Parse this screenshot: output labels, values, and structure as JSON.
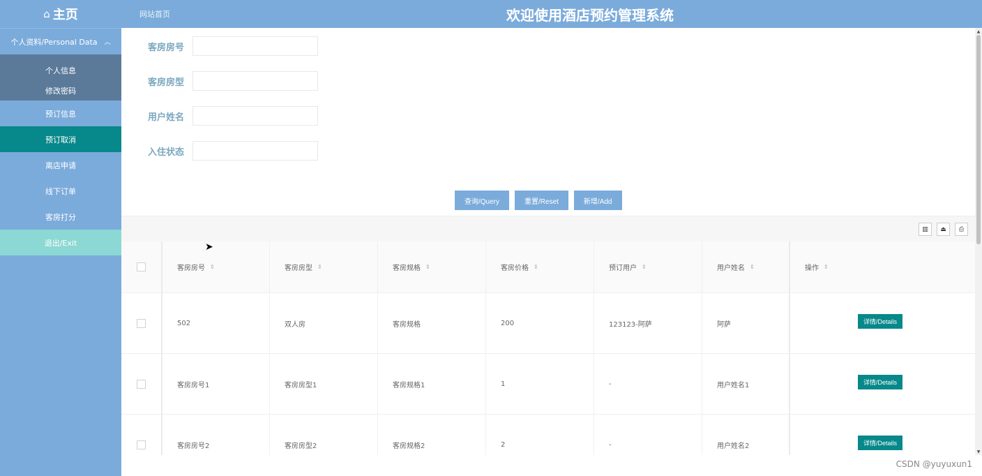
{
  "header": {
    "home_label": "主页",
    "site_link": "网站首页",
    "title": "欢迎使用酒店预约管理系统"
  },
  "sidebar": {
    "group_label": "个人资料/Personal Data",
    "sub_items": [
      {
        "label": "个人信息"
      },
      {
        "label": "修改密码"
      }
    ],
    "items": [
      {
        "label": "预订信息"
      },
      {
        "label": "预订取消"
      },
      {
        "label": "离店申请"
      },
      {
        "label": "线下订单"
      },
      {
        "label": "客房打分"
      },
      {
        "label": "退出/Exit"
      }
    ]
  },
  "form": {
    "fields": [
      {
        "label": "客房房号",
        "value": ""
      },
      {
        "label": "客房房型",
        "value": ""
      },
      {
        "label": "用户姓名",
        "value": ""
      },
      {
        "label": "入住状态",
        "value": ""
      }
    ],
    "query_label": "查询/Query",
    "reset_label": "重置/Reset",
    "add_label": "新增/Add"
  },
  "table": {
    "columns": [
      "客房房号",
      "客房房型",
      "客房规格",
      "客房价格",
      "预订用户",
      "用户姓名",
      "操作"
    ],
    "rows": [
      [
        "502",
        "双人房",
        "客房规格",
        "200",
        "123123-阿萨",
        "阿萨"
      ],
      [
        "客房房号1",
        "客房房型1",
        "客房规格1",
        "1",
        "-",
        "用户姓名1"
      ],
      [
        "客房房号2",
        "客房房型2",
        "客房规格2",
        "2",
        "-",
        "用户姓名2"
      ]
    ],
    "details_label": "详情/Details"
  },
  "watermark": "CSDN @yuyuxun1",
  "colors": {
    "primary": "#7babdb",
    "teal": "#07888a",
    "exit": "#8cd8d4",
    "submenu": "#5b7a9a"
  }
}
